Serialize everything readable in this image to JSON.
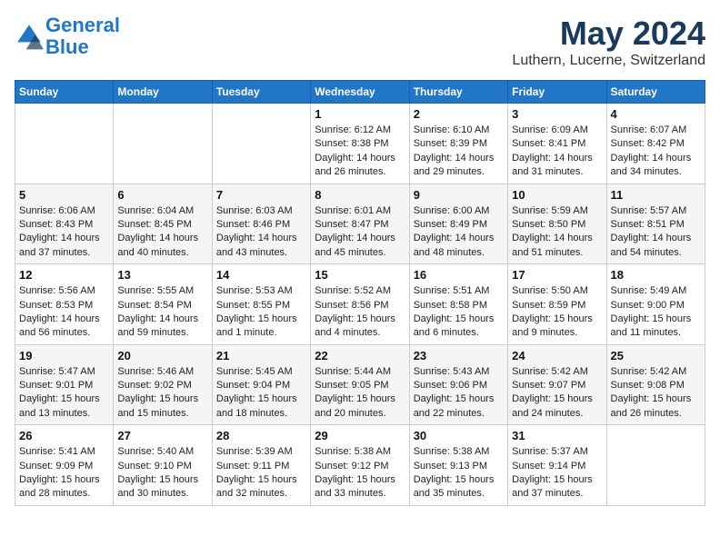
{
  "logo": {
    "line1": "General",
    "line2": "Blue"
  },
  "title": "May 2024",
  "location": "Luthern, Lucerne, Switzerland",
  "weekdays": [
    "Sunday",
    "Monday",
    "Tuesday",
    "Wednesday",
    "Thursday",
    "Friday",
    "Saturday"
  ],
  "weeks": [
    [
      {
        "day": "",
        "info": ""
      },
      {
        "day": "",
        "info": ""
      },
      {
        "day": "",
        "info": ""
      },
      {
        "day": "1",
        "info": "Sunrise: 6:12 AM\nSunset: 8:38 PM\nDaylight: 14 hours and 26 minutes."
      },
      {
        "day": "2",
        "info": "Sunrise: 6:10 AM\nSunset: 8:39 PM\nDaylight: 14 hours and 29 minutes."
      },
      {
        "day": "3",
        "info": "Sunrise: 6:09 AM\nSunset: 8:41 PM\nDaylight: 14 hours and 31 minutes."
      },
      {
        "day": "4",
        "info": "Sunrise: 6:07 AM\nSunset: 8:42 PM\nDaylight: 14 hours and 34 minutes."
      }
    ],
    [
      {
        "day": "5",
        "info": "Sunrise: 6:06 AM\nSunset: 8:43 PM\nDaylight: 14 hours and 37 minutes."
      },
      {
        "day": "6",
        "info": "Sunrise: 6:04 AM\nSunset: 8:45 PM\nDaylight: 14 hours and 40 minutes."
      },
      {
        "day": "7",
        "info": "Sunrise: 6:03 AM\nSunset: 8:46 PM\nDaylight: 14 hours and 43 minutes."
      },
      {
        "day": "8",
        "info": "Sunrise: 6:01 AM\nSunset: 8:47 PM\nDaylight: 14 hours and 45 minutes."
      },
      {
        "day": "9",
        "info": "Sunrise: 6:00 AM\nSunset: 8:49 PM\nDaylight: 14 hours and 48 minutes."
      },
      {
        "day": "10",
        "info": "Sunrise: 5:59 AM\nSunset: 8:50 PM\nDaylight: 14 hours and 51 minutes."
      },
      {
        "day": "11",
        "info": "Sunrise: 5:57 AM\nSunset: 8:51 PM\nDaylight: 14 hours and 54 minutes."
      }
    ],
    [
      {
        "day": "12",
        "info": "Sunrise: 5:56 AM\nSunset: 8:53 PM\nDaylight: 14 hours and 56 minutes."
      },
      {
        "day": "13",
        "info": "Sunrise: 5:55 AM\nSunset: 8:54 PM\nDaylight: 14 hours and 59 minutes."
      },
      {
        "day": "14",
        "info": "Sunrise: 5:53 AM\nSunset: 8:55 PM\nDaylight: 15 hours and 1 minute."
      },
      {
        "day": "15",
        "info": "Sunrise: 5:52 AM\nSunset: 8:56 PM\nDaylight: 15 hours and 4 minutes."
      },
      {
        "day": "16",
        "info": "Sunrise: 5:51 AM\nSunset: 8:58 PM\nDaylight: 15 hours and 6 minutes."
      },
      {
        "day": "17",
        "info": "Sunrise: 5:50 AM\nSunset: 8:59 PM\nDaylight: 15 hours and 9 minutes."
      },
      {
        "day": "18",
        "info": "Sunrise: 5:49 AM\nSunset: 9:00 PM\nDaylight: 15 hours and 11 minutes."
      }
    ],
    [
      {
        "day": "19",
        "info": "Sunrise: 5:47 AM\nSunset: 9:01 PM\nDaylight: 15 hours and 13 minutes."
      },
      {
        "day": "20",
        "info": "Sunrise: 5:46 AM\nSunset: 9:02 PM\nDaylight: 15 hours and 15 minutes."
      },
      {
        "day": "21",
        "info": "Sunrise: 5:45 AM\nSunset: 9:04 PM\nDaylight: 15 hours and 18 minutes."
      },
      {
        "day": "22",
        "info": "Sunrise: 5:44 AM\nSunset: 9:05 PM\nDaylight: 15 hours and 20 minutes."
      },
      {
        "day": "23",
        "info": "Sunrise: 5:43 AM\nSunset: 9:06 PM\nDaylight: 15 hours and 22 minutes."
      },
      {
        "day": "24",
        "info": "Sunrise: 5:42 AM\nSunset: 9:07 PM\nDaylight: 15 hours and 24 minutes."
      },
      {
        "day": "25",
        "info": "Sunrise: 5:42 AM\nSunset: 9:08 PM\nDaylight: 15 hours and 26 minutes."
      }
    ],
    [
      {
        "day": "26",
        "info": "Sunrise: 5:41 AM\nSunset: 9:09 PM\nDaylight: 15 hours and 28 minutes."
      },
      {
        "day": "27",
        "info": "Sunrise: 5:40 AM\nSunset: 9:10 PM\nDaylight: 15 hours and 30 minutes."
      },
      {
        "day": "28",
        "info": "Sunrise: 5:39 AM\nSunset: 9:11 PM\nDaylight: 15 hours and 32 minutes."
      },
      {
        "day": "29",
        "info": "Sunrise: 5:38 AM\nSunset: 9:12 PM\nDaylight: 15 hours and 33 minutes."
      },
      {
        "day": "30",
        "info": "Sunrise: 5:38 AM\nSunset: 9:13 PM\nDaylight: 15 hours and 35 minutes."
      },
      {
        "day": "31",
        "info": "Sunrise: 5:37 AM\nSunset: 9:14 PM\nDaylight: 15 hours and 37 minutes."
      },
      {
        "day": "",
        "info": ""
      }
    ]
  ]
}
